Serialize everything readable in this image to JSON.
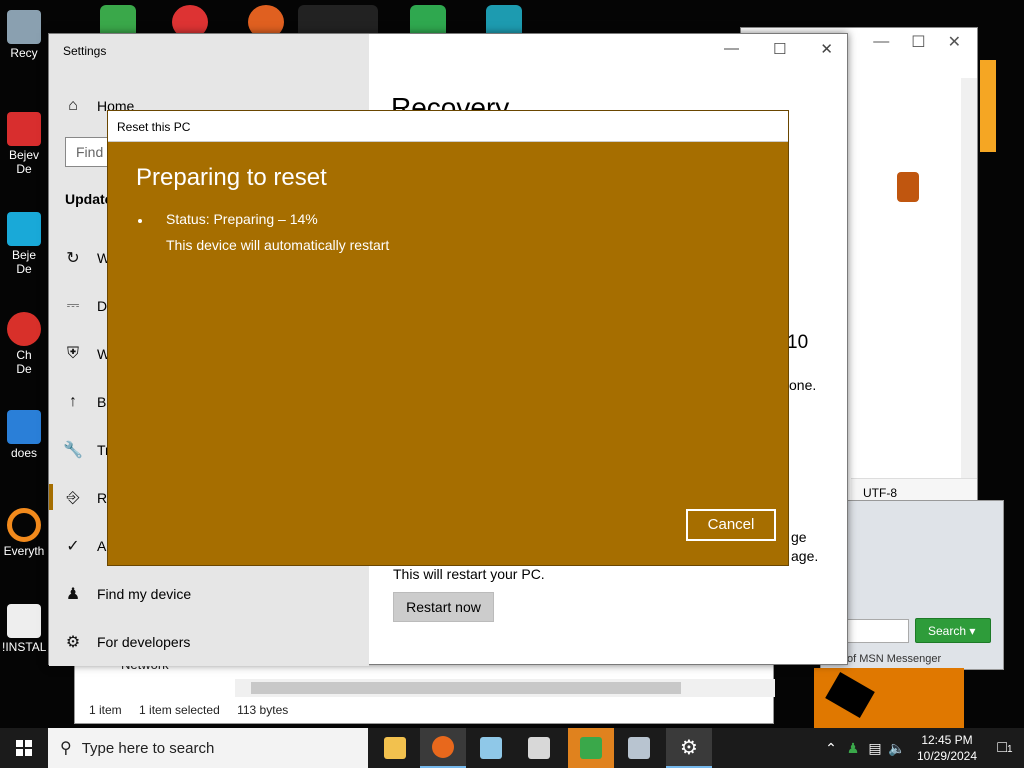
{
  "desktop": {
    "icons": [
      {
        "label": "Recy"
      },
      {
        "label": "Bejev\nDe"
      },
      {
        "label": "Beje\nDe"
      },
      {
        "label": "Ch\nDe"
      },
      {
        "label": "does"
      },
      {
        "label": "Everyth"
      },
      {
        "label": "!INSTALL"
      }
    ]
  },
  "background_window": {
    "status_encoding": "UTF-8"
  },
  "msn": {
    "search_placeholder": "...",
    "search_button": "Search",
    "caption": "of MSN Messenger"
  },
  "explorer": {
    "network_label": "Network",
    "status": {
      "items": "1 item",
      "selected": "1 item selected",
      "size": "113 bytes"
    }
  },
  "settings": {
    "window_title": "Settings",
    "find_placeholder": "Find",
    "section_title": "Update",
    "nav": [
      {
        "label": "Home",
        "icon": "home-icon"
      },
      {
        "label": "W",
        "icon": "sync-icon"
      },
      {
        "label": "De",
        "icon": "delivery-icon"
      },
      {
        "label": "W",
        "icon": "shield-icon"
      },
      {
        "label": "Ba",
        "icon": "backup-icon"
      },
      {
        "label": "Tr",
        "icon": "wrench-icon"
      },
      {
        "label": "Re",
        "icon": "recovery-icon"
      },
      {
        "label": "Ac",
        "icon": "activation-icon"
      },
      {
        "label": "Find my device",
        "icon": "person-location-icon"
      },
      {
        "label": "For developers",
        "icon": "developer-tools-icon"
      }
    ],
    "main": {
      "title": "Recovery",
      "frag_version": "10",
      "frag_one": "one.",
      "frag_ge": "ge",
      "frag_age": "age.",
      "restart_text": "This will restart your PC.",
      "restart_button": "Restart now"
    }
  },
  "dialog": {
    "title": "Reset this PC",
    "heading": "Preparing to reset",
    "status": "Status: Preparing – 14%",
    "note": "This device will automatically restart",
    "cancel": "Cancel",
    "progress_percent": 14,
    "background_color": "#a66e00"
  },
  "taskbar": {
    "search_placeholder": "Type here to search",
    "apps": [
      "file-explorer-icon",
      "firefox-icon",
      "notepad-icon",
      "app-icon",
      "msn-messenger-icon",
      "remote-desktop-icon",
      "settings-gear-icon"
    ],
    "clock": {
      "time": "12:45 PM",
      "date": "10/29/2024"
    },
    "notification_count": "1"
  }
}
